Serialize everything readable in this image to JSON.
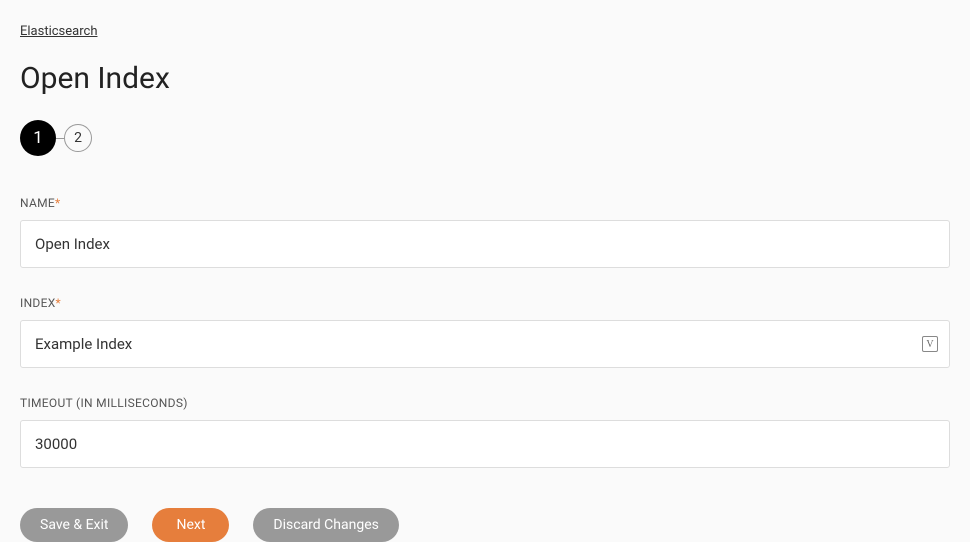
{
  "breadcrumb": {
    "label": "Elasticsearch"
  },
  "page": {
    "title": "Open Index"
  },
  "stepper": {
    "step1": "1",
    "step2": "2",
    "activeStep": 1
  },
  "form": {
    "name": {
      "label": "NAME",
      "required": true,
      "value": "Open Index"
    },
    "index": {
      "label": "INDEX",
      "required": true,
      "value": "Example Index"
    },
    "timeout": {
      "label": "TIMEOUT (IN MILLISECONDS)",
      "required": false,
      "value": "30000"
    }
  },
  "buttons": {
    "saveExit": "Save & Exit",
    "next": "Next",
    "discard": "Discard Changes"
  },
  "requiredMarker": "*"
}
